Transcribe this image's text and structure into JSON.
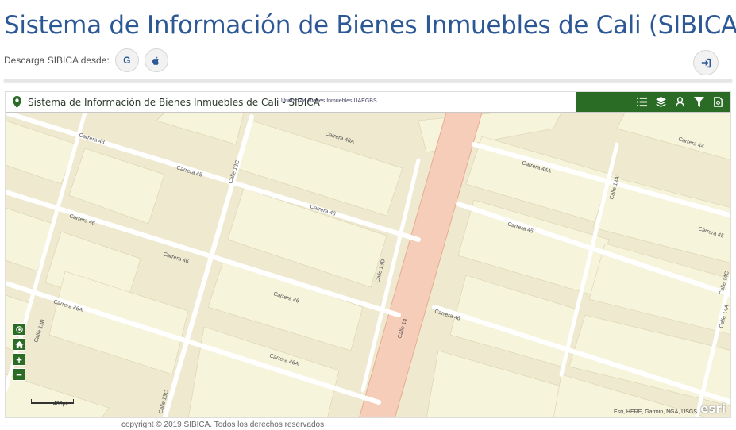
{
  "header": {
    "title": "Sistema de Información de Bienes Inmuebles de Cali (SIBICA)",
    "download_label": "Descarga SIBICA desde:",
    "download_buttons": [
      {
        "icon": "google-icon",
        "glyph": "G"
      },
      {
        "icon": "apple-icon"
      }
    ],
    "login_icon": "sign-in-icon"
  },
  "map": {
    "title": "Sistema de Información de Bienes Inmuebles de Cali - SIBICA",
    "subtitle": "Unidad de Bienes Inmuebles UAEGBS",
    "toolbar": [
      "list-icon",
      "layers-icon",
      "analysis-icon",
      "filter-icon",
      "print-icon"
    ],
    "controls": [
      "locate-icon",
      "home-icon",
      "zoom-in-icon",
      "zoom-out-icon"
    ],
    "zoom_in_glyph": "+",
    "zoom_out_glyph": "−",
    "scale_label": "400pie",
    "attribution": "Esri, HERE, Garmin, NGA, USGS",
    "esri_logo": "esri",
    "street_labels": {
      "c43": "Carrera 43",
      "c45a": "Carrera 45",
      "c46a": "Carrera 46",
      "c46b": "Carrera 46",
      "c46c": "Carrera 46",
      "c46d": "Carrera 46",
      "c46ab": "Carrera 46A",
      "c46ac": "Carrera 46A",
      "c46ad": "Carrera 46A",
      "cll13c": "Calle 13C",
      "cll13d": "Calle 13D",
      "cll13b": "Calle 13B",
      "cll14": "Calle 14",
      "cll14a": "Calle 14A",
      "cll14c": "Calle 14C",
      "c44a": "Carrera 44",
      "c44ab": "Carrera 44A",
      "c45b": "Carrera 45",
      "c45c": "Carrera 45",
      "c46r": "Carrera 46",
      "c14a_r": "Calle 14A",
      "cll13c_b": "Calle 13C"
    }
  },
  "colors": {
    "title": "#2c5896",
    "toolbar_bg": "#2a6b25",
    "map_bg": "#eee9cf",
    "block": "#f7f4dc",
    "road": "#ffffff",
    "arterial": "#f6cdb8"
  },
  "footer": {
    "text": "copyright © 2019 SIBICA. Todos los derechos reservados"
  }
}
